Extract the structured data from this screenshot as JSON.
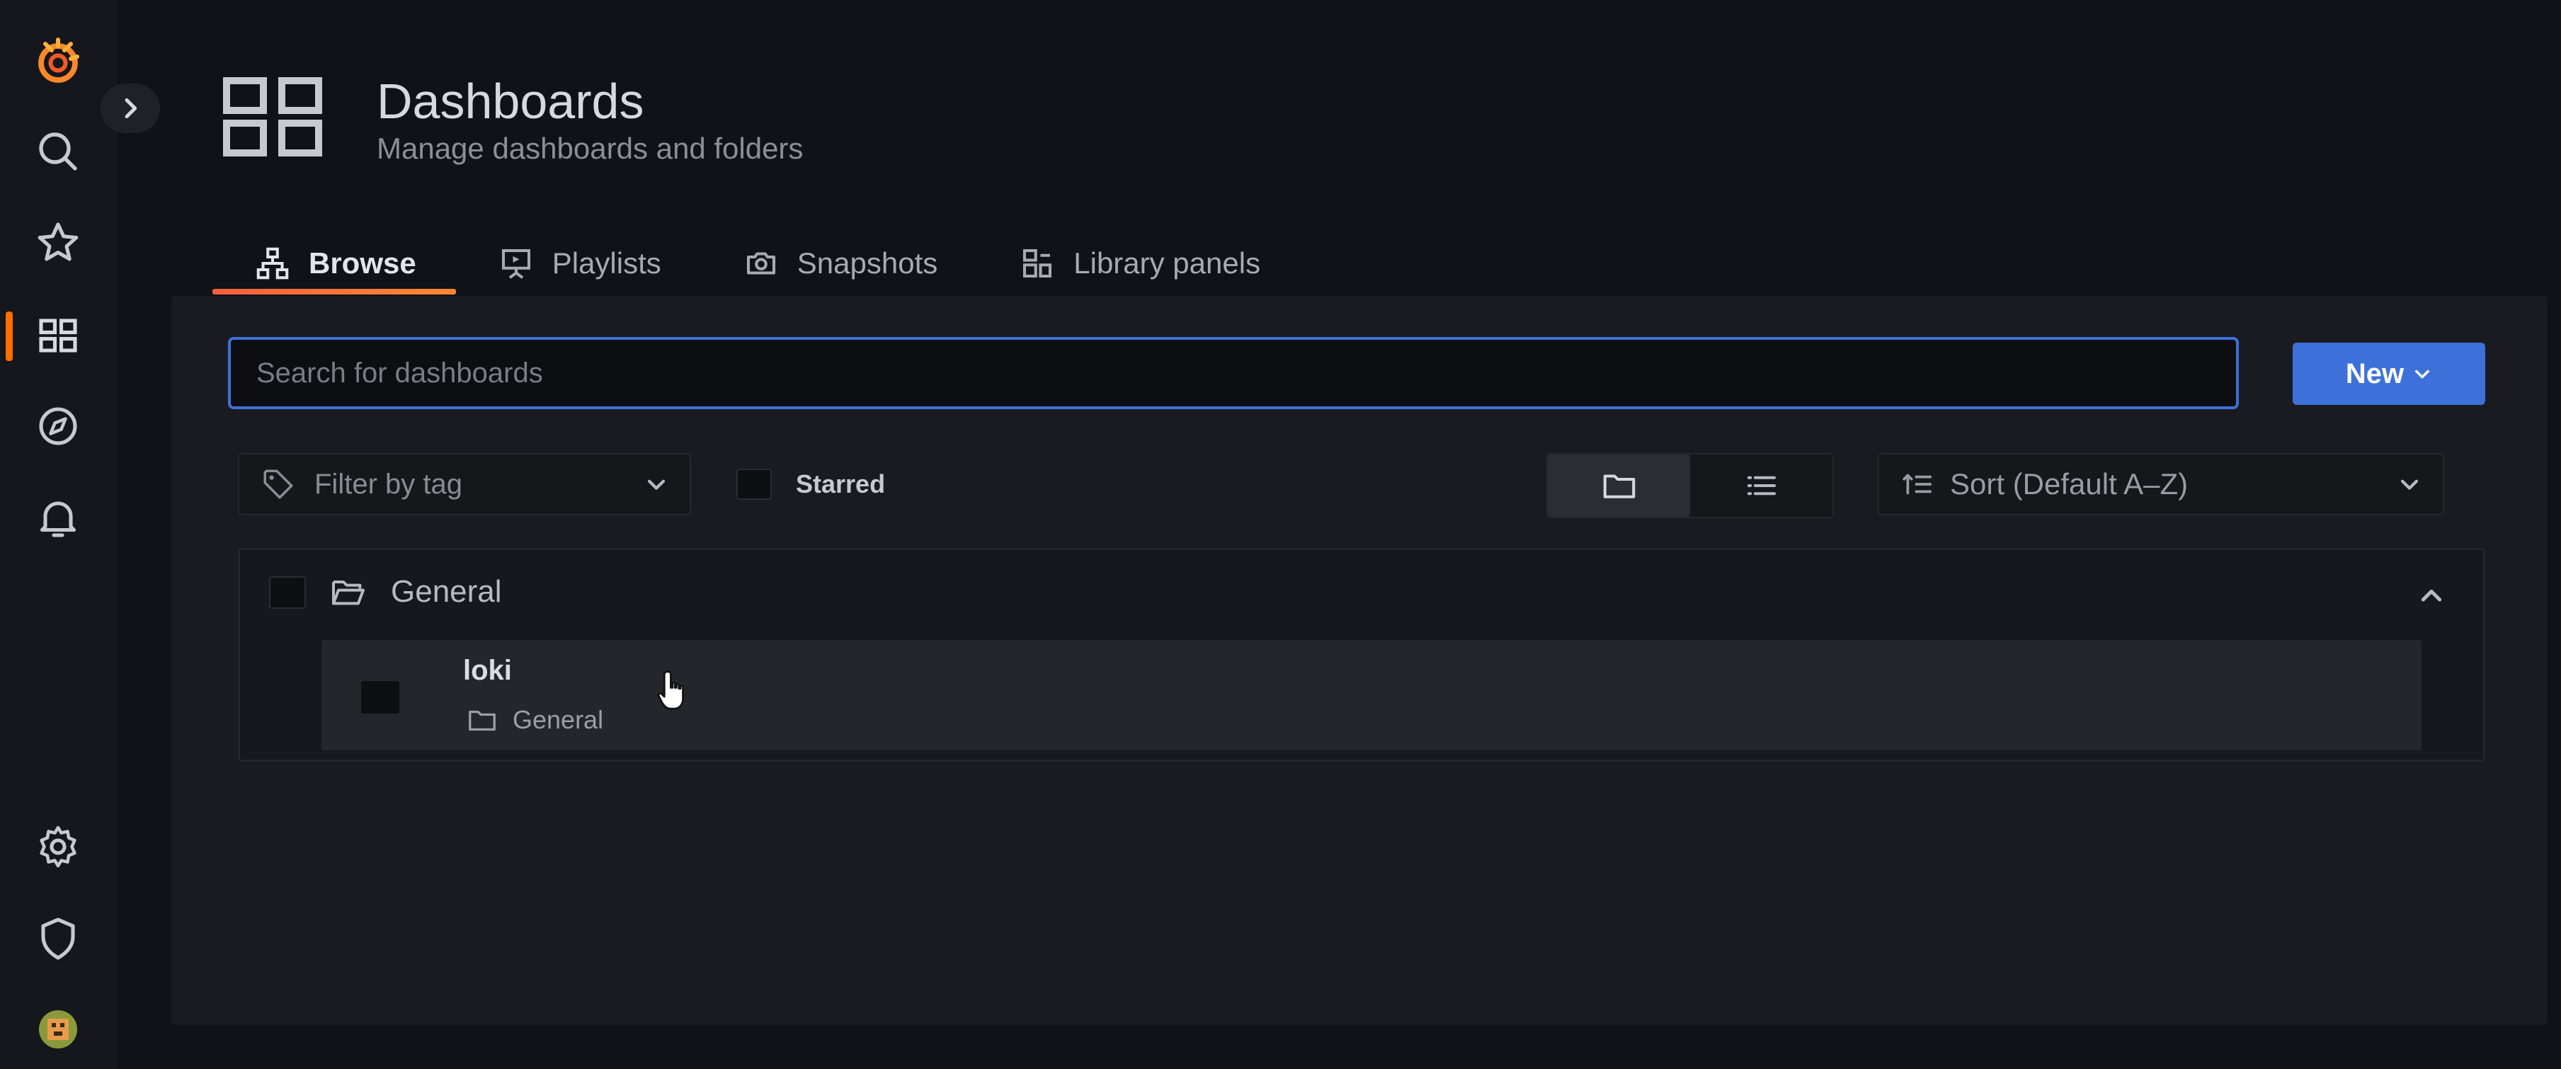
{
  "sidebar": {
    "items": [
      {
        "icon": "grafana-logo-icon"
      },
      {
        "icon": "search-icon"
      },
      {
        "icon": "star-icon"
      },
      {
        "icon": "dashboards-grid-icon",
        "active": true
      },
      {
        "icon": "compass-explore-icon"
      },
      {
        "icon": "bell-alerting-icon"
      },
      {
        "icon": "gear-configuration-icon"
      },
      {
        "icon": "shield-admin-icon"
      },
      {
        "icon": "user-avatar-icon"
      }
    ],
    "active_color": "#ff6e00"
  },
  "header": {
    "title": "Dashboards",
    "subtitle": "Manage dashboards and folders"
  },
  "tabs": [
    {
      "label": "Browse",
      "icon": "sitemap-icon",
      "active": true
    },
    {
      "label": "Playlists",
      "icon": "presentation-icon"
    },
    {
      "label": "Snapshots",
      "icon": "camera-icon"
    },
    {
      "label": "Library panels",
      "icon": "library-panels-icon"
    }
  ],
  "search": {
    "placeholder": "Search for dashboards",
    "value": ""
  },
  "new_button": {
    "label": "New"
  },
  "filters": {
    "tag_placeholder": "Filter by tag",
    "starred_label": "Starred",
    "view_mode": "folders",
    "sort_label": "Sort (Default A–Z)"
  },
  "folders": [
    {
      "title": "General",
      "expanded": true,
      "dashboards": [
        {
          "name": "loki",
          "folder": "General"
        }
      ]
    }
  ],
  "colors": {
    "accent": "#3d71d9",
    "tab_underline": "#ff8833",
    "background": "#111217"
  }
}
